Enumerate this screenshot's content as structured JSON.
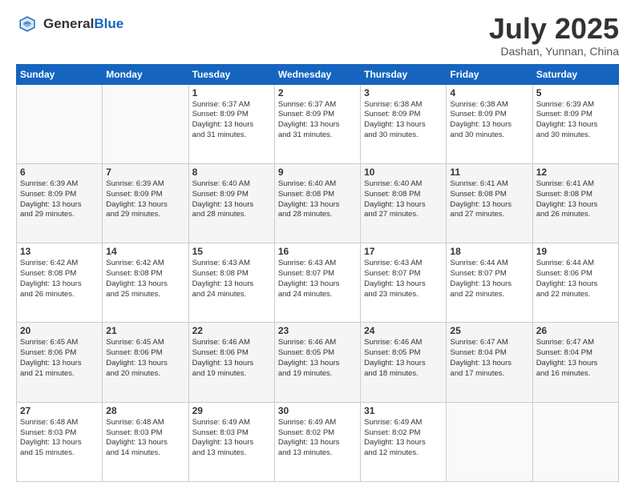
{
  "header": {
    "logo_line1": "General",
    "logo_line2": "Blue",
    "month": "July 2025",
    "location": "Dashan, Yunnan, China"
  },
  "weekdays": [
    "Sunday",
    "Monday",
    "Tuesday",
    "Wednesday",
    "Thursday",
    "Friday",
    "Saturday"
  ],
  "weeks": [
    [
      {
        "day": "",
        "info": ""
      },
      {
        "day": "",
        "info": ""
      },
      {
        "day": "1",
        "info": "Sunrise: 6:37 AM\nSunset: 8:09 PM\nDaylight: 13 hours\nand 31 minutes."
      },
      {
        "day": "2",
        "info": "Sunrise: 6:37 AM\nSunset: 8:09 PM\nDaylight: 13 hours\nand 31 minutes."
      },
      {
        "day": "3",
        "info": "Sunrise: 6:38 AM\nSunset: 8:09 PM\nDaylight: 13 hours\nand 30 minutes."
      },
      {
        "day": "4",
        "info": "Sunrise: 6:38 AM\nSunset: 8:09 PM\nDaylight: 13 hours\nand 30 minutes."
      },
      {
        "day": "5",
        "info": "Sunrise: 6:39 AM\nSunset: 8:09 PM\nDaylight: 13 hours\nand 30 minutes."
      }
    ],
    [
      {
        "day": "6",
        "info": "Sunrise: 6:39 AM\nSunset: 8:09 PM\nDaylight: 13 hours\nand 29 minutes."
      },
      {
        "day": "7",
        "info": "Sunrise: 6:39 AM\nSunset: 8:09 PM\nDaylight: 13 hours\nand 29 minutes."
      },
      {
        "day": "8",
        "info": "Sunrise: 6:40 AM\nSunset: 8:09 PM\nDaylight: 13 hours\nand 28 minutes."
      },
      {
        "day": "9",
        "info": "Sunrise: 6:40 AM\nSunset: 8:08 PM\nDaylight: 13 hours\nand 28 minutes."
      },
      {
        "day": "10",
        "info": "Sunrise: 6:40 AM\nSunset: 8:08 PM\nDaylight: 13 hours\nand 27 minutes."
      },
      {
        "day": "11",
        "info": "Sunrise: 6:41 AM\nSunset: 8:08 PM\nDaylight: 13 hours\nand 27 minutes."
      },
      {
        "day": "12",
        "info": "Sunrise: 6:41 AM\nSunset: 8:08 PM\nDaylight: 13 hours\nand 26 minutes."
      }
    ],
    [
      {
        "day": "13",
        "info": "Sunrise: 6:42 AM\nSunset: 8:08 PM\nDaylight: 13 hours\nand 26 minutes."
      },
      {
        "day": "14",
        "info": "Sunrise: 6:42 AM\nSunset: 8:08 PM\nDaylight: 13 hours\nand 25 minutes."
      },
      {
        "day": "15",
        "info": "Sunrise: 6:43 AM\nSunset: 8:08 PM\nDaylight: 13 hours\nand 24 minutes."
      },
      {
        "day": "16",
        "info": "Sunrise: 6:43 AM\nSunset: 8:07 PM\nDaylight: 13 hours\nand 24 minutes."
      },
      {
        "day": "17",
        "info": "Sunrise: 6:43 AM\nSunset: 8:07 PM\nDaylight: 13 hours\nand 23 minutes."
      },
      {
        "day": "18",
        "info": "Sunrise: 6:44 AM\nSunset: 8:07 PM\nDaylight: 13 hours\nand 22 minutes."
      },
      {
        "day": "19",
        "info": "Sunrise: 6:44 AM\nSunset: 8:06 PM\nDaylight: 13 hours\nand 22 minutes."
      }
    ],
    [
      {
        "day": "20",
        "info": "Sunrise: 6:45 AM\nSunset: 8:06 PM\nDaylight: 13 hours\nand 21 minutes."
      },
      {
        "day": "21",
        "info": "Sunrise: 6:45 AM\nSunset: 8:06 PM\nDaylight: 13 hours\nand 20 minutes."
      },
      {
        "day": "22",
        "info": "Sunrise: 6:46 AM\nSunset: 8:06 PM\nDaylight: 13 hours\nand 19 minutes."
      },
      {
        "day": "23",
        "info": "Sunrise: 6:46 AM\nSunset: 8:05 PM\nDaylight: 13 hours\nand 19 minutes."
      },
      {
        "day": "24",
        "info": "Sunrise: 6:46 AM\nSunset: 8:05 PM\nDaylight: 13 hours\nand 18 minutes."
      },
      {
        "day": "25",
        "info": "Sunrise: 6:47 AM\nSunset: 8:04 PM\nDaylight: 13 hours\nand 17 minutes."
      },
      {
        "day": "26",
        "info": "Sunrise: 6:47 AM\nSunset: 8:04 PM\nDaylight: 13 hours\nand 16 minutes."
      }
    ],
    [
      {
        "day": "27",
        "info": "Sunrise: 6:48 AM\nSunset: 8:03 PM\nDaylight: 13 hours\nand 15 minutes."
      },
      {
        "day": "28",
        "info": "Sunrise: 6:48 AM\nSunset: 8:03 PM\nDaylight: 13 hours\nand 14 minutes."
      },
      {
        "day": "29",
        "info": "Sunrise: 6:49 AM\nSunset: 8:03 PM\nDaylight: 13 hours\nand 13 minutes."
      },
      {
        "day": "30",
        "info": "Sunrise: 6:49 AM\nSunset: 8:02 PM\nDaylight: 13 hours\nand 13 minutes."
      },
      {
        "day": "31",
        "info": "Sunrise: 6:49 AM\nSunset: 8:02 PM\nDaylight: 13 hours\nand 12 minutes."
      },
      {
        "day": "",
        "info": ""
      },
      {
        "day": "",
        "info": ""
      }
    ]
  ]
}
